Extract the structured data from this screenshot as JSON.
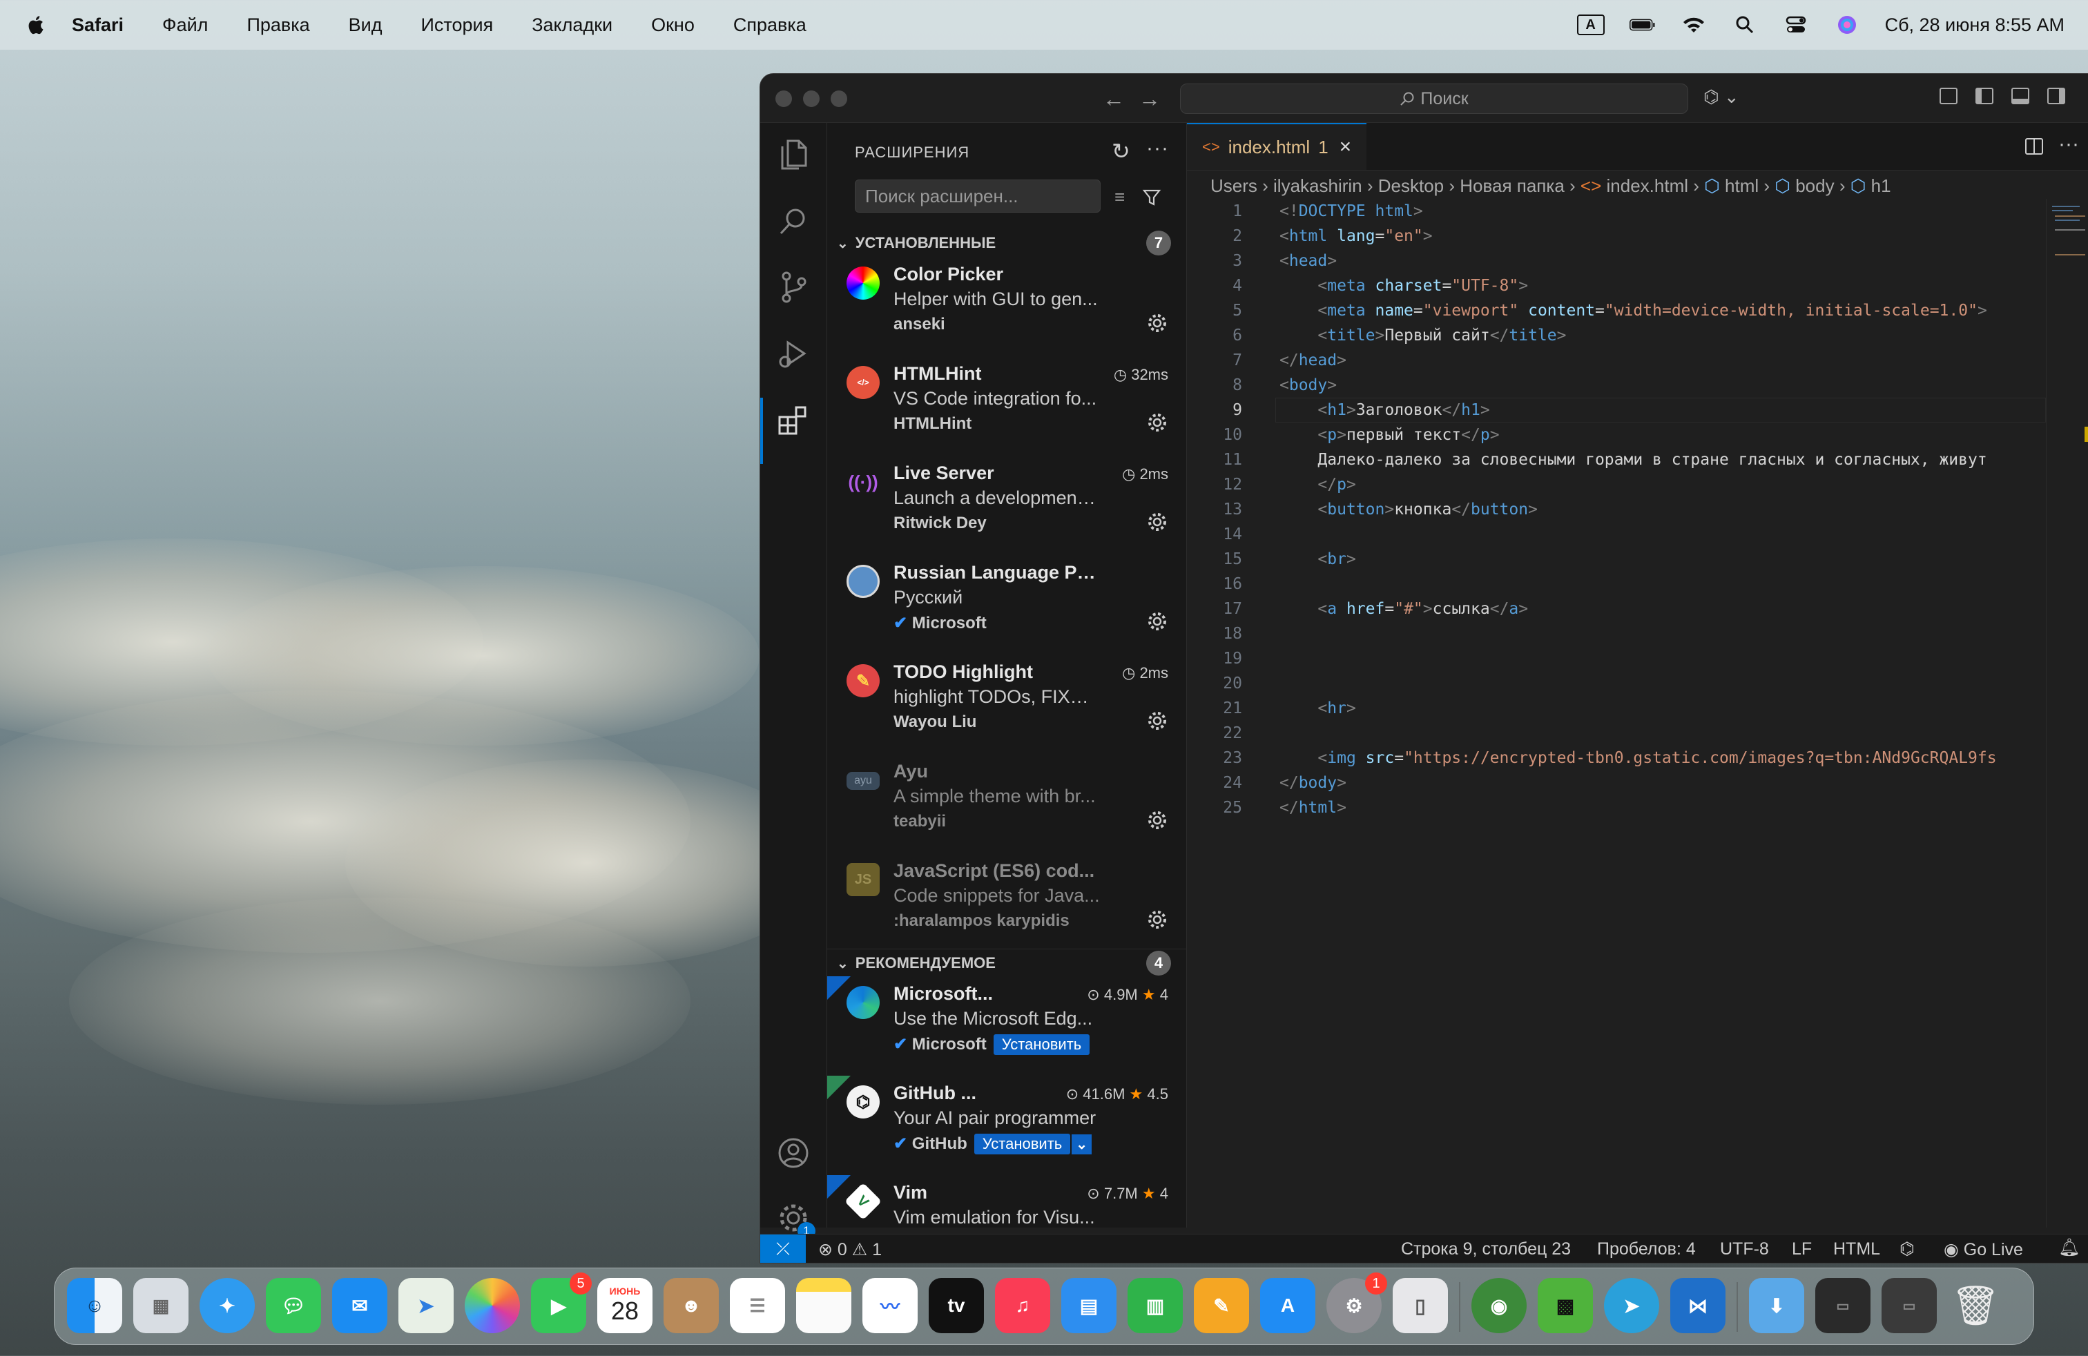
{
  "menubar": {
    "app": "Safari",
    "items": [
      "Файл",
      "Правка",
      "Вид",
      "История",
      "Закладки",
      "Окно",
      "Справка"
    ],
    "input_indicator": "A",
    "datetime": "Сб, 28 июня  8:55 AM"
  },
  "window": {
    "search_placeholder": "Поиск",
    "sidebar": {
      "title": "РАСШИРЕНИЯ",
      "search_placeholder": "Поиск расширен...",
      "installed_header": "УСТАНОВЛЕННЫЕ",
      "installed_count": "7",
      "installed": [
        {
          "name": "Color Picker",
          "desc": "Helper with GUI to gen...",
          "publisher": "anseki",
          "time": ""
        },
        {
          "name": "HTMLHint",
          "desc": "VS Code integration fo...",
          "publisher": "HTMLHint",
          "time": "32ms"
        },
        {
          "name": "Live Server",
          "desc": "Launch a development ...",
          "publisher": "Ritwick Dey",
          "time": "2ms"
        },
        {
          "name": "Russian Language Pa...",
          "desc": "Русский",
          "publisher": "Microsoft",
          "time": ""
        },
        {
          "name": "TODO Highlight",
          "desc": "highlight TODOs, FIXM...",
          "publisher": "Wayou Liu",
          "time": "2ms"
        },
        {
          "name": "Ayu",
          "desc": "A simple theme with br...",
          "publisher": "teabyii",
          "time": ""
        },
        {
          "name": "JavaScript (ES6) cod...",
          "desc": "Code snippets for Java...",
          "publisher": ":haralampos karypidis",
          "time": ""
        }
      ],
      "recommended_header": "РЕКОМЕНДУЕМОЕ",
      "recommended_count": "4",
      "recommended": [
        {
          "name": "Microsoft...",
          "desc": "Use the Microsoft Edg...",
          "publisher": "Microsoft",
          "downloads": "4.9M",
          "rating": "4",
          "install": "Установить"
        },
        {
          "name": "GitHub ...",
          "desc": "Your AI pair programmer",
          "publisher": "GitHub",
          "downloads": "41.6M",
          "rating": "4.5",
          "install": "Установить"
        },
        {
          "name": "Vim",
          "desc": "Vim emulation for Visu...",
          "publisher": "",
          "downloads": "7.7M",
          "rating": "4",
          "install": ""
        }
      ],
      "settings_badge": "1"
    },
    "tab": {
      "label": "index.html",
      "problems": "1"
    },
    "breadcrumbs": [
      "Users",
      "ilyakashirin",
      "Desktop",
      "Новая папка",
      "index.html",
      "html",
      "body",
      "h1"
    ],
    "code_lines": [
      "<!DOCTYPE html>",
      "<html lang=\"en\">",
      "<head>",
      "    <meta charset=\"UTF-8\">",
      "    <meta name=\"viewport\" content=\"width=device-width, initial-scale=1.0\">",
      "    <title>Первый сайт</title>",
      "</head>",
      "<body>",
      "    <h1>Заголовок</h1>",
      "    <p>первый текст</p>",
      "    Далеко-далеко за словесными горами в стране гласных и согласных, живут",
      "    </p>",
      "    <button>кнопка</button>",
      "",
      "    <br>",
      "",
      "    <a href=\"#\">ссылка</a>",
      "",
      "",
      "",
      "    <hr>",
      "",
      "    <img src=\"https://encrypted-tbn0.gstatic.com/images?q=tbn:ANd9GcRQAL9fs",
      "</body>",
      "</html>"
    ],
    "current_line": 9,
    "status": {
      "errors": "0",
      "warnings": "1",
      "position": "Строка 9, столбец 23",
      "spaces": "Пробелов: 4",
      "encoding": "UTF-8",
      "eol": "LF",
      "language": "HTML",
      "golive": "Go Live"
    }
  },
  "dock": {
    "calendar_month": "ИЮНЬ",
    "calendar_day": "28",
    "facetime_badge": "5",
    "settings_badge": "1",
    "tv_label": "tv"
  },
  "colors": {
    "accent": "#0078d4",
    "tab_modified": "#e2c08d",
    "install": "#0e63c5"
  }
}
